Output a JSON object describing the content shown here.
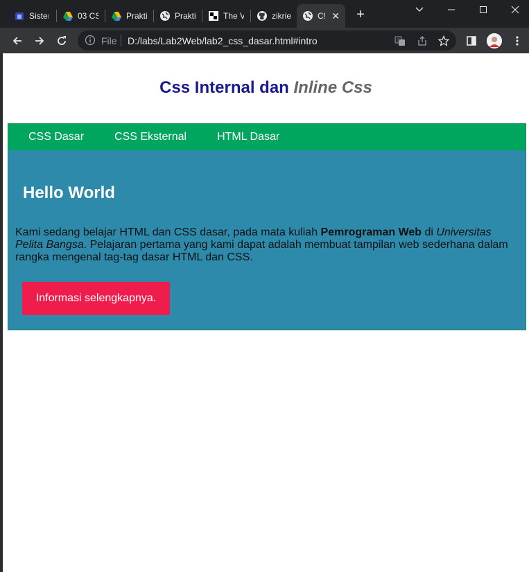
{
  "browser": {
    "tabs": [
      {
        "title": "Sistem",
        "icon": "app-icon",
        "active": false
      },
      {
        "title": "03 CS",
        "icon": "google-drive-icon",
        "active": false
      },
      {
        "title": "Prakti",
        "icon": "google-drive-icon",
        "active": false
      },
      {
        "title": "Prakti",
        "icon": "globe-icon",
        "active": false
      },
      {
        "title": "The V",
        "icon": "site-icon",
        "active": false
      },
      {
        "title": "zikrie",
        "icon": "github-icon",
        "active": false
      },
      {
        "title": "C!",
        "icon": "globe-icon",
        "active": true
      }
    ],
    "omnibox": {
      "scheme_label": "File",
      "url": "D:/labs/Lab2Web/lab2_css_dasar.html#intro"
    },
    "colors": {
      "chrome_dark": "#202124",
      "chrome_toolbar": "#35363a"
    }
  },
  "page": {
    "heading_main": "Css Internal dan",
    "heading_inline": "Inline Css",
    "nav": [
      "CSS Dasar",
      "CSS Eksternal",
      "HTML Dasar"
    ],
    "intro": {
      "title": "Hello World",
      "text_1": "Kami sedang belajar HTML dan CSS dasar, pada mata kuliah ",
      "text_bold": "Pemrograman Web",
      "text_2": " di ",
      "text_italic": "Universitas Pelita Bangsa",
      "text_3": ". Pelajaran pertama yang kami dapat adalah membuat tampilan web sederhana dalam rangka mengenal tag-tag dasar HTML dan CSS.",
      "button": "Informasi selengkapnya."
    },
    "colors": {
      "heading": "#1a1a8e",
      "heading_inline": "#666666",
      "navbar": "#00a65e",
      "intro_bg": "#2e8aab",
      "button": "#ef1d4b"
    }
  }
}
